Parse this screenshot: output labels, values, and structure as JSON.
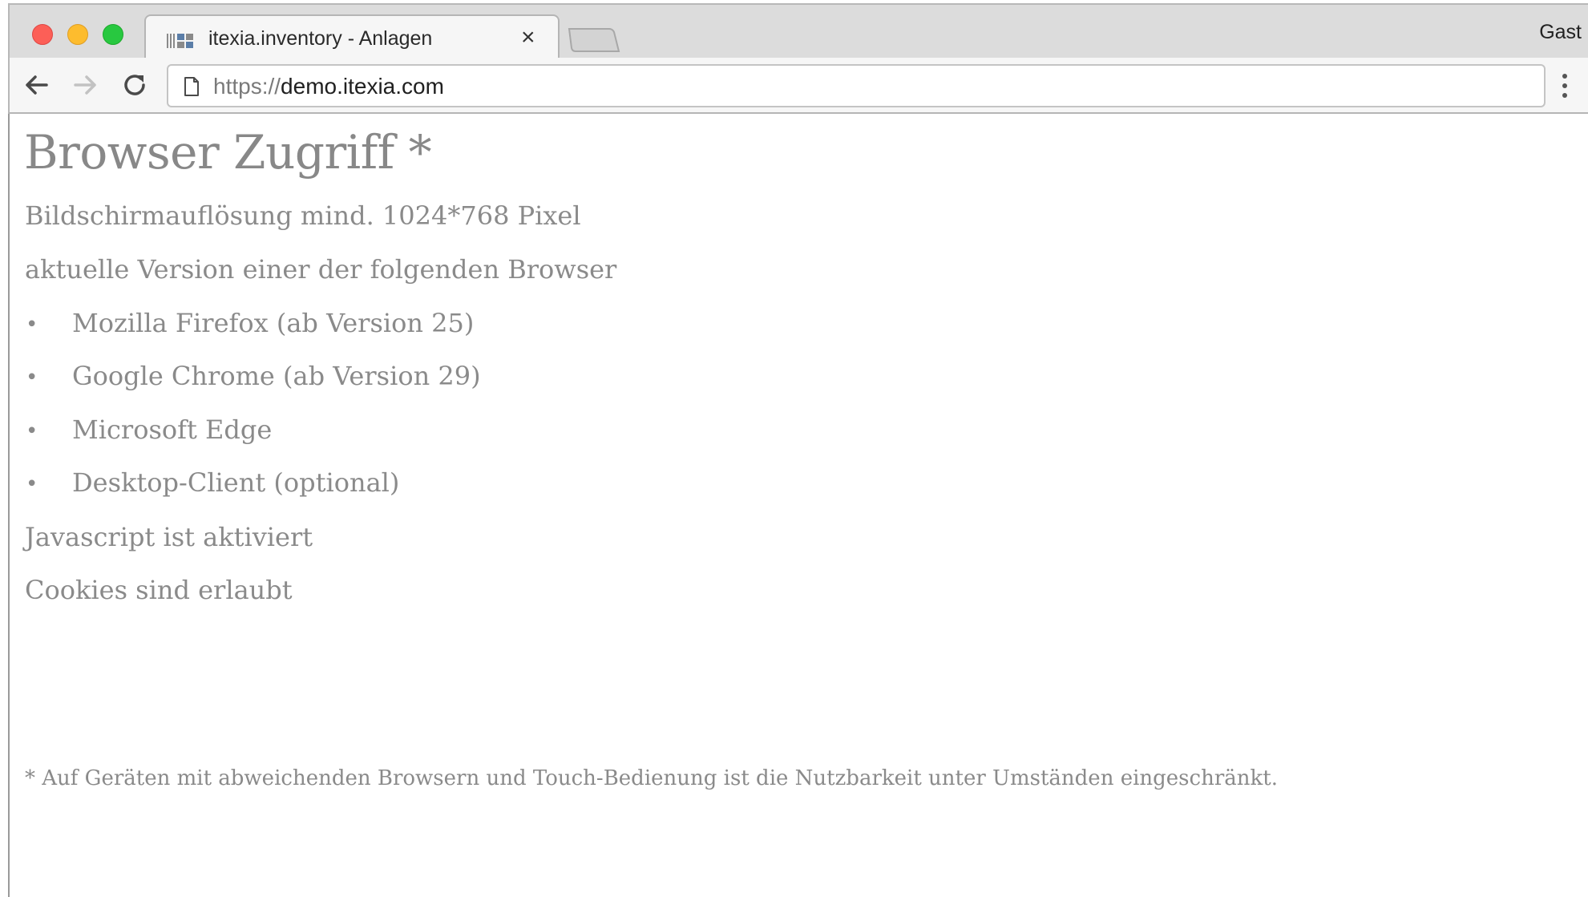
{
  "browser": {
    "tab": {
      "title": "itexia.inventory - Anlagen",
      "close_label": "×"
    },
    "profile_label": "Gast",
    "address": {
      "scheme": "https://",
      "host": "demo.itexia.com"
    },
    "icons": {
      "close": "close-icon",
      "new_tab": "new-tab-icon",
      "back": "back-arrow-icon",
      "forward": "forward-arrow-icon",
      "reload": "reload-icon",
      "page": "page-icon",
      "menu": "kebab-menu-icon",
      "favicon": "itexia-favicon"
    },
    "colors": {
      "close_dot": "#fc5f57",
      "minimize_dot": "#fdbc2e",
      "maximize_dot": "#28c840"
    }
  },
  "page": {
    "heading": "Browser Zugriff *",
    "resolution": "Bildschirmauflösung mind. 1024*768 Pixel",
    "browsers_intro": "aktuelle Version einer der folgenden Browser",
    "bullet_char": "•",
    "browsers": [
      "Mozilla Firefox (ab Version 25)",
      "Google Chrome (ab Version 29)",
      "Microsoft Edge",
      "Desktop-Client (optional)"
    ],
    "javascript": "Javascript ist aktiviert",
    "cookies": "Cookies sind erlaubt",
    "footnote": "* Auf Geräten mit abweichenden Browsern und Touch-Bedienung ist die Nutzbarkeit unter Umständen eingeschränkt.",
    "text_color": "#8a8a8a"
  }
}
